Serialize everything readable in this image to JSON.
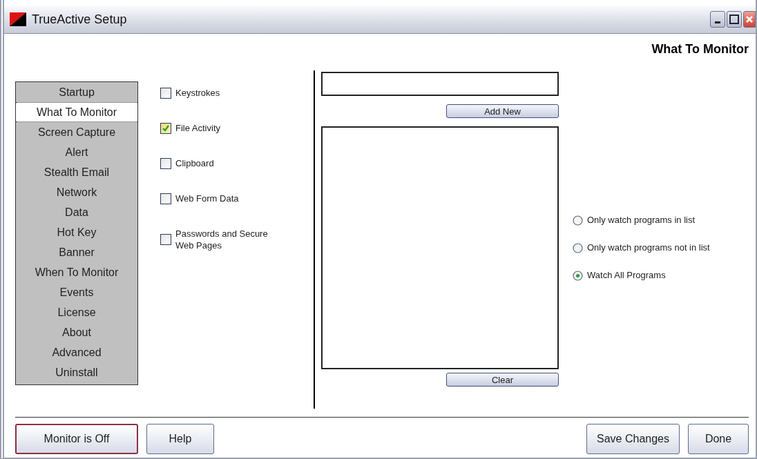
{
  "window": {
    "title": "TrueActive Setup"
  },
  "heading": "What To Monitor",
  "sidebar": {
    "items": [
      {
        "label": "Startup",
        "selected": false
      },
      {
        "label": "What To Monitor",
        "selected": true
      },
      {
        "label": "Screen Capture",
        "selected": false
      },
      {
        "label": "Alert",
        "selected": false
      },
      {
        "label": "Stealth Email",
        "selected": false
      },
      {
        "label": "Network",
        "selected": false
      },
      {
        "label": "Data",
        "selected": false
      },
      {
        "label": "Hot Key",
        "selected": false
      },
      {
        "label": "Banner",
        "selected": false
      },
      {
        "label": "When To Monitor",
        "selected": false
      },
      {
        "label": "Events",
        "selected": false
      },
      {
        "label": "License",
        "selected": false
      },
      {
        "label": "About",
        "selected": false
      },
      {
        "label": "Advanced",
        "selected": false
      },
      {
        "label": "Uninstall",
        "selected": false
      }
    ]
  },
  "options": [
    {
      "label": "Keystrokes",
      "checked": false
    },
    {
      "label": "File Activity",
      "checked": true
    },
    {
      "label": "Clipboard",
      "checked": false
    },
    {
      "label": "Web Form Data",
      "checked": false
    },
    {
      "label": "Passwords and Secure Web Pages",
      "checked": false
    }
  ],
  "add_button": "Add New",
  "clear_button": "Clear",
  "watch_modes": [
    {
      "label": "Only watch programs in list",
      "selected": false
    },
    {
      "label": "Only watch programs not in list",
      "selected": false
    },
    {
      "label": "Watch All Programs",
      "selected": true
    }
  ],
  "footer": {
    "monitor_button": "Monitor is Off",
    "help_button": "Help",
    "save_button": "Save Changes",
    "done_button": "Done"
  }
}
